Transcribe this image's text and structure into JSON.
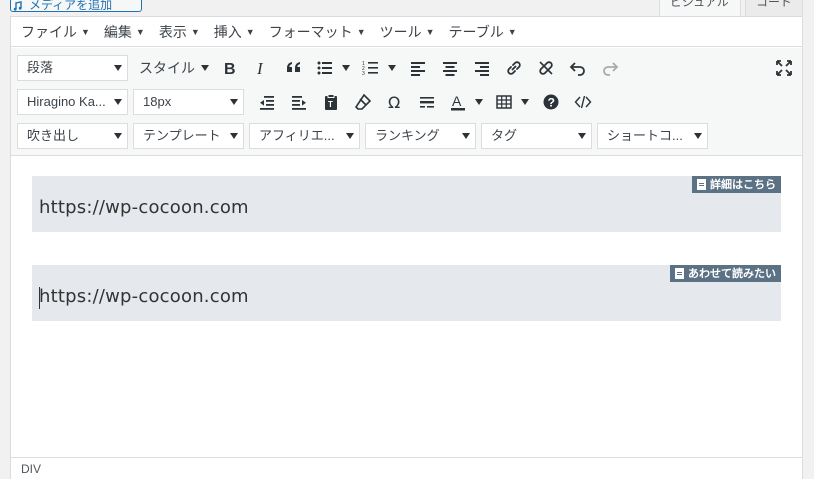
{
  "header": {
    "add_media_label": "メディアを追加",
    "tabs": [
      {
        "label": "ビジュアル",
        "active": true
      },
      {
        "label": "コード",
        "active": false
      }
    ]
  },
  "menubar": {
    "items": [
      "ファイル",
      "編集",
      "表示",
      "挿入",
      "フォーマット",
      "ツール",
      "テーブル"
    ]
  },
  "toolbar": {
    "row1": {
      "format_select": "段落",
      "style_label": "スタイル",
      "buttons": [
        "bold-icon",
        "italic-icon",
        "blockquote-icon",
        "bullet-list-icon",
        "numbered-list-icon",
        "align-left-icon",
        "align-center-icon",
        "align-right-icon",
        "link-icon",
        "unlink-icon",
        "undo-icon",
        "redo-icon",
        "fullscreen-icon"
      ]
    },
    "row2": {
      "font_family": "Hiragino Ka...",
      "font_size": "18px",
      "buttons": [
        "outdent-icon",
        "indent-icon",
        "paste-text-icon",
        "clear-format-icon",
        "special-char-icon",
        "horizontal-rule-icon",
        "text-color-icon",
        "table-icon",
        "help-icon",
        "code-icon"
      ]
    },
    "row3": {
      "selects": [
        "吹き出し",
        "テンプレート",
        "アフィリエ...",
        "ランキング",
        "タグ",
        "ショートコ..."
      ]
    }
  },
  "content": {
    "cards": [
      {
        "url": "https://wp-cocoon.com",
        "label": "詳細はこちら"
      },
      {
        "url": "https://wp-cocoon.com",
        "label": "あわせて読みたい"
      }
    ]
  },
  "status": {
    "path": "DIV"
  },
  "colors": {
    "card_bg": "#e5e9ed",
    "card_label_bg": "#5b7184",
    "accent": "#2271b1"
  }
}
